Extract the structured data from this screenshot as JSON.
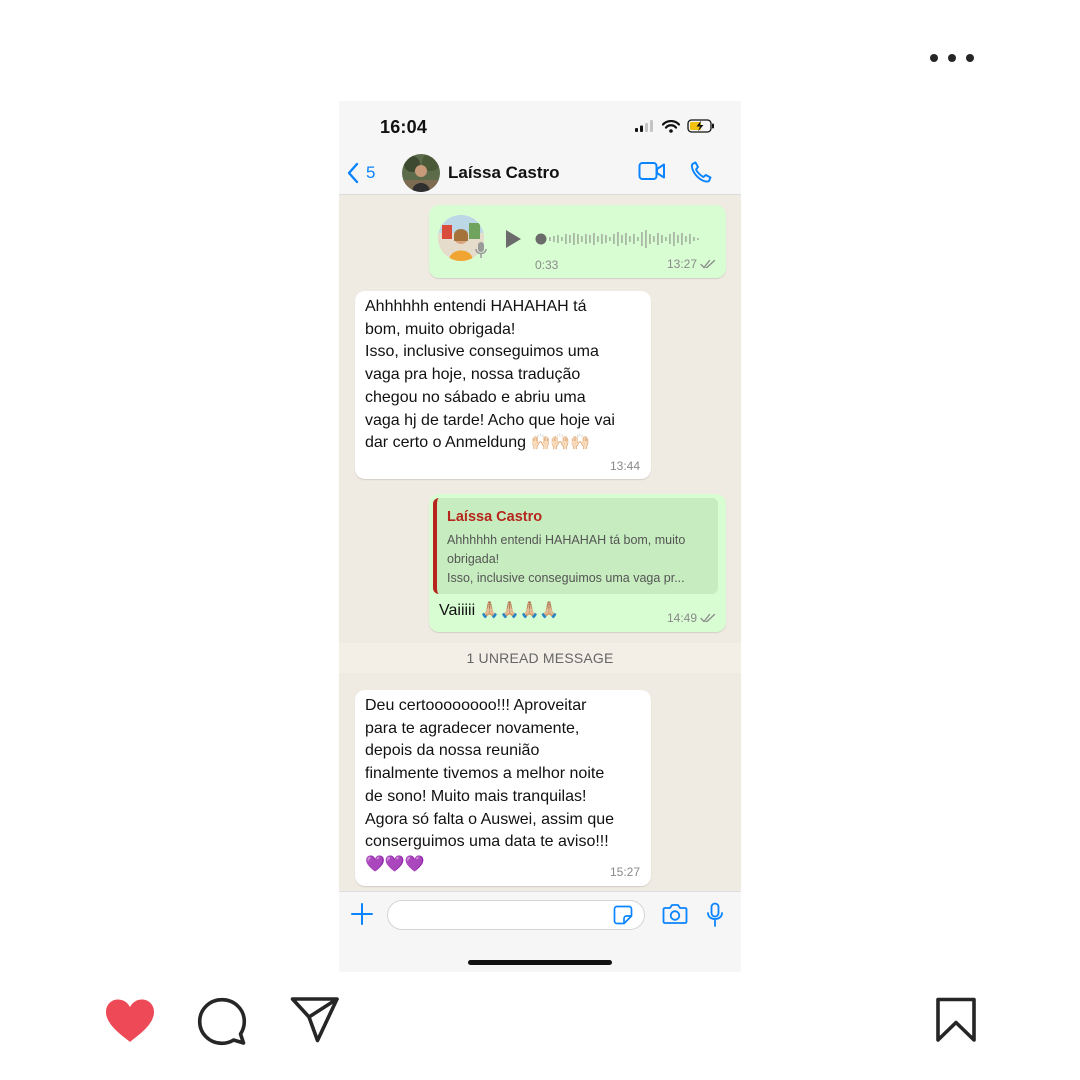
{
  "post": {
    "more_icon": "more-horizontal-icon",
    "actions": {
      "like_icon": "heart-filled-icon",
      "comment_icon": "comment-icon",
      "share_icon": "paper-plane-icon",
      "save_icon": "bookmark-icon",
      "like_color": "#ed4956"
    }
  },
  "phone": {
    "status_bar": {
      "time": "16:04"
    },
    "header": {
      "back_count": "5",
      "contact_name": "Laíssa Castro"
    },
    "messages": [
      {
        "type": "voice",
        "direction": "outgoing",
        "duration": "0:33",
        "time": "13:27",
        "status": "read"
      },
      {
        "type": "text",
        "direction": "incoming",
        "text": "Ahhhhhh entendi HAHAHAH tá\nbom, muito obrigada!\nIsso, inclusive conseguimos uma\nvaga pra hoje, nossa tradução\nchegou no sábado e abriu uma\nvaga hj de tarde! Acho que hoje vai\ndar certo o Anmeldung 🙌🏻🙌🏻🙌🏻",
        "time": "13:44"
      },
      {
        "type": "reply",
        "direction": "outgoing",
        "quoted_name": "Laíssa Castro",
        "quoted_text": "Ahhhhhh entendi HAHAHAH tá bom, muito\nobrigada!\nIsso, inclusive conseguimos uma vaga pr...",
        "text": "Vaiiiii 🙏🏼🙏🏼🙏🏼🙏🏼",
        "time": "14:49",
        "status": "read"
      },
      {
        "type": "text",
        "direction": "incoming",
        "text": "Deu certoooooooo!!! Aproveitar\npara te agradecer novamente,\ndepois da nossa reunião\nfinalmente tivemos a melhor noite\nde sono! Muito mais tranquilas!\nAgora só falta o Auswei, assim que\nconserguimos uma data te aviso!!!\n💜💜💜",
        "time": "15:27"
      }
    ],
    "unread_banner": "1 UNREAD MESSAGE",
    "input": {
      "value": "",
      "placeholder": ""
    },
    "colors": {
      "accent": "#0a84ff",
      "outgoing_bubble": "#d9fdd3",
      "incoming_bubble": "#ffffff",
      "chat_background": "#efeae2",
      "quote_name": "#b6261c"
    }
  }
}
